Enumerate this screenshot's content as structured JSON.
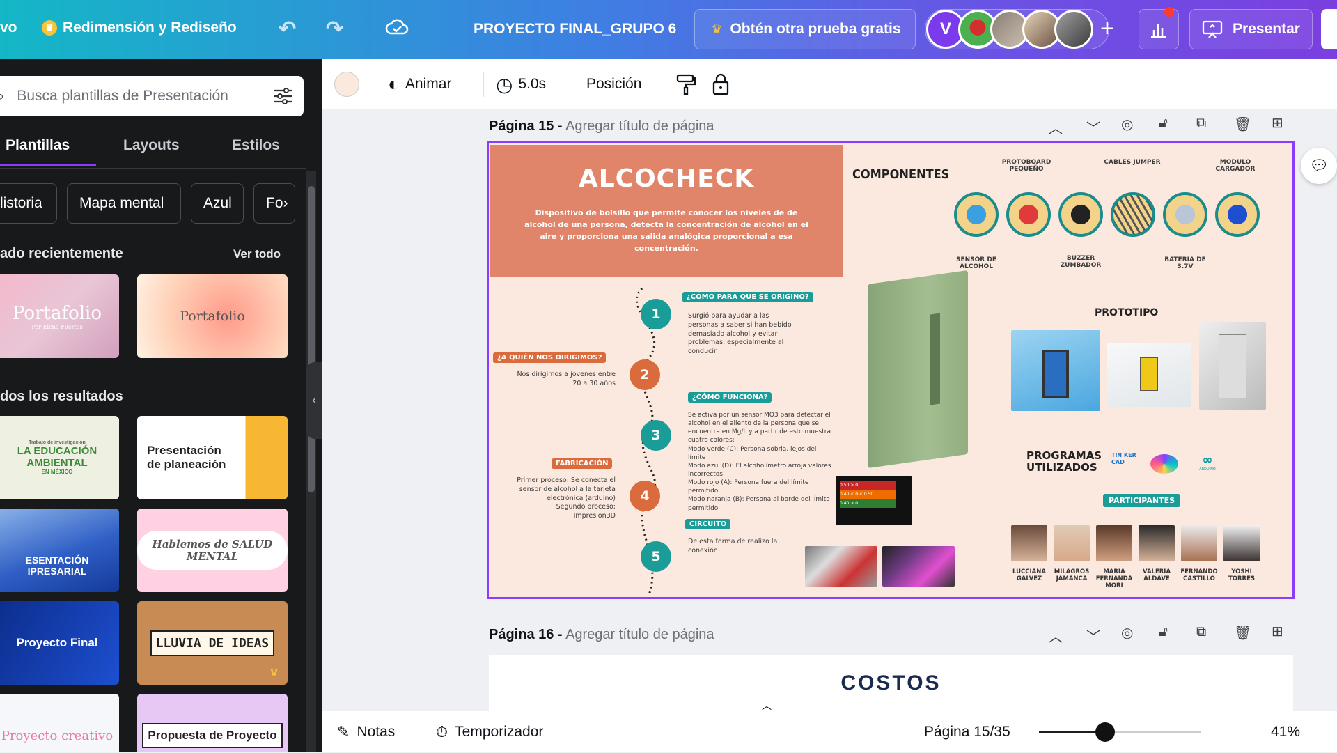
{
  "topbar": {
    "home_partial": "vo",
    "design_name": "Redimensión y Rediseño",
    "project_title": "PROYECTO FINAL_GRUPO 6",
    "trial_label": "Obtén otra prueba gratis",
    "avatar_initial": "V",
    "present_label": "Presentar"
  },
  "sidebar": {
    "search_placeholder": "Busca plantillas de Presentación",
    "tabs": [
      "Plantillas",
      "Layouts",
      "Estilos"
    ],
    "chips": [
      "listoria",
      "Mapa mental",
      "Azul",
      "Fo"
    ],
    "recent_title": "ado recientemente",
    "see_all": "Ver todo",
    "recent": [
      {
        "title": "Portafolio",
        "subtitle": "Por Elena Fuertes"
      },
      {
        "title": "Portafolio"
      }
    ],
    "results_title": "dos los resultados",
    "results": [
      {
        "title": "LA EDUCACIÓN AMBIENTAL",
        "top": "Trabajo de investigación",
        "sub": "EN MÉXICO"
      },
      {
        "title": "Presentación de planeación"
      },
      {
        "title": "ESENTACIÓN IPRESARIAL"
      },
      {
        "title": "Hablemos de SALUD MENTAL"
      },
      {
        "title": "Proyecto Final"
      },
      {
        "title": "LLUVIA DE IDEAS"
      },
      {
        "title": "Proyecto creativo"
      },
      {
        "title": "Propuesta de Proyecto"
      }
    ]
  },
  "toolbar": {
    "animate": "Animar",
    "duration": "5.0s",
    "position": "Posición"
  },
  "page15": {
    "label": "Página 15 -",
    "subtitle": "Agregar título de página"
  },
  "page16": {
    "label": "Página 16 -",
    "subtitle": "Agregar título de página",
    "title": "COSTOS"
  },
  "slide": {
    "title": "ALCOCHECK",
    "description": "Dispositivo de bolsillo que permite conocer los niveles de de alcohol de una persona, detecta la concentración de alcohol en el aire y proporciona una salida analógica proporcional a esa concentración.",
    "components_title": "COMPONENTES",
    "components": [
      {
        "top": "",
        "bottom": "SENSOR DE ALCOHOL"
      },
      {
        "top": "PROTOBOARD PEQUEÑO",
        "bottom": ""
      },
      {
        "top": "",
        "bottom": "BUZZER ZUMBADOR"
      },
      {
        "top": "CABLES JUMPER",
        "bottom": ""
      },
      {
        "top": "",
        "bottom": "BATERIA DE 3.7V"
      },
      {
        "top": "MODULO CARGADOR",
        "bottom": ""
      }
    ],
    "q1_title": "¿CÓMO PARA QUE SE ORIGINÓ?",
    "q1_text": "Surgió para ayudar a las personas a saber si han bebido demasiado alcohol y evitar problemas, especialmente al conducir.",
    "q2_title": "¿A QUIÉN NOS DIRIGIMOS?",
    "q2_text": "Nos dirigimos a jóvenes entre 20 a 30 años",
    "q3_title": "¿CÓMO FUNCIONA?",
    "q3_text": "Se activa por un sensor MQ3 para detectar el alcohol en el aliento de la persona que se encuentra en Mg/L y a partir de esto muestra cuatro colores:",
    "q3_modes": [
      "Modo verde (C): Persona sobria, lejos del límite",
      "Modo azul (D): El alcoholímetro arroja valores incorrectos",
      "Modo rojo (A): Persona fuera del límite permitido.",
      "Modo naranja (B): Persona al borde del límite permitido."
    ],
    "q4_title": "FABRICACIÓN",
    "q4_text": "Primer proceso: Se conecta el sensor de alcohol a la tarjeta electrónica (arduino) Segundo proceso: Impresion3D",
    "q5_title": "CIRCUITO",
    "q5_text": "De esta forma de realizo la conexión:",
    "steps": [
      "1",
      "2",
      "3",
      "4",
      "5"
    ],
    "prototype_title": "PROTOTIPO",
    "programs_title": "PROGRAMAS UTILIZADOS",
    "tinkercad": "TIN KER CAD",
    "arduino": "ARDUINO",
    "participants_title": "PARTICIPANTES",
    "participants": [
      "LUCCIANA GALVEZ",
      "MILAGROS JAMANCA",
      "MARIA FERNANDA MORI",
      "VALERIA ALDAVE",
      "FERNANDO CASTILLO",
      "YOSHI TORRES"
    ],
    "chart_values": [
      "0.50 > 0",
      "0.40 < 0 < 0.50",
      "0.40 > 0"
    ]
  },
  "footer": {
    "notes": "Notas",
    "timer": "Temporizador",
    "page_count": "Página 15/35",
    "zoom": "41%",
    "zoom_level": 0.41
  }
}
